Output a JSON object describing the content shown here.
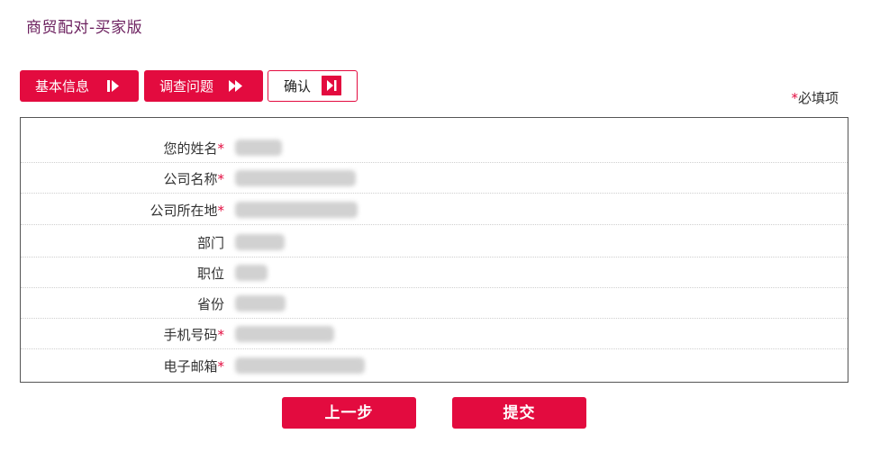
{
  "page": {
    "title": "商贸配对-买家版"
  },
  "steps": [
    {
      "label": "基本信息",
      "icon": "play-pause-icon",
      "state": "done"
    },
    {
      "label": "调查问题",
      "icon": "fast-forward-icon",
      "state": "done"
    },
    {
      "label": "确认",
      "icon": "skip-end-icon",
      "state": "current"
    }
  ],
  "required_note": {
    "star": "*",
    "text": "必填项"
  },
  "form": {
    "rows": [
      {
        "label": "您的姓名",
        "required": true
      },
      {
        "label": "公司名称",
        "required": true
      },
      {
        "label": "公司所在地",
        "required": true
      },
      {
        "label": "部门",
        "required": false
      },
      {
        "label": "职位",
        "required": false
      },
      {
        "label": "省份",
        "required": false
      },
      {
        "label": "手机号码",
        "required": true
      },
      {
        "label": "电子邮箱",
        "required": true
      }
    ],
    "required_star": "*"
  },
  "buttons": {
    "prev": "上一步",
    "submit": "提交"
  },
  "colors": {
    "accent": "#e30b3f",
    "title": "#6b1f5e"
  }
}
